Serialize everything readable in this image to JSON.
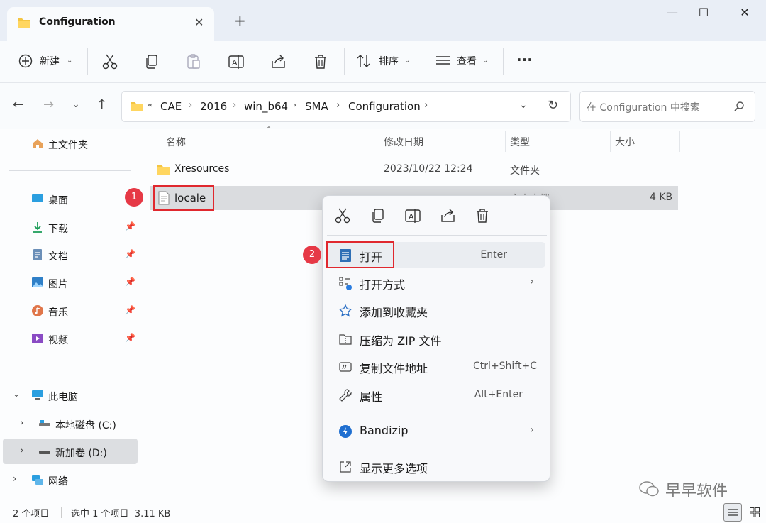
{
  "window": {
    "tab_title": "Configuration",
    "new_tab": "+",
    "minimize": "—",
    "maximize": "☐",
    "close": "✕"
  },
  "toolbar": {
    "new_label": "新建",
    "sort_label": "排序",
    "view_label": "查看",
    "more_label": "···"
  },
  "address": {
    "crumbs": [
      "«",
      "CAE",
      "2016",
      "win_b64",
      "SMA",
      "Configuration"
    ],
    "search_placeholder": "在 Configuration 中搜索"
  },
  "sidebar": {
    "home": "主文件夹",
    "quick": [
      {
        "label": "桌面"
      },
      {
        "label": "下载"
      },
      {
        "label": "文档"
      },
      {
        "label": "图片"
      },
      {
        "label": "音乐"
      },
      {
        "label": "视频"
      }
    ],
    "this_pc": "此电脑",
    "drives": [
      "本地磁盘 (C:)",
      "新加卷 (D:)"
    ],
    "network": "网络"
  },
  "columns": {
    "name": "名称",
    "date": "修改日期",
    "type": "类型",
    "size": "大小"
  },
  "files": [
    {
      "name": "Xresources",
      "date": "2023/10/22 12:24",
      "type": "文件夹",
      "size": ""
    },
    {
      "name": "locale",
      "date": "",
      "type": "文本文档",
      "size": "4 KB"
    }
  ],
  "context_menu": {
    "items": [
      {
        "label": "打开",
        "shortcut": "Enter"
      },
      {
        "label": "打开方式",
        "shortcut": ""
      },
      {
        "label": "添加到收藏夹",
        "shortcut": ""
      },
      {
        "label": "压缩为 ZIP 文件",
        "shortcut": ""
      },
      {
        "label": "复制文件地址",
        "shortcut": "Ctrl+Shift+C"
      },
      {
        "label": "属性",
        "shortcut": "Alt+Enter"
      }
    ],
    "bandizip": "Bandizip",
    "more_options": "显示更多选项",
    "chevron": "›"
  },
  "badges": [
    "1",
    "2"
  ],
  "status": {
    "count": "2 个项目",
    "selected": "选中 1 个项目  3.11 KB"
  },
  "watermark": "早早软件",
  "colors": {
    "accent": "#0067c0",
    "folder": "#f4c542",
    "badge": "#e63946",
    "highlight": "#e0282e"
  }
}
